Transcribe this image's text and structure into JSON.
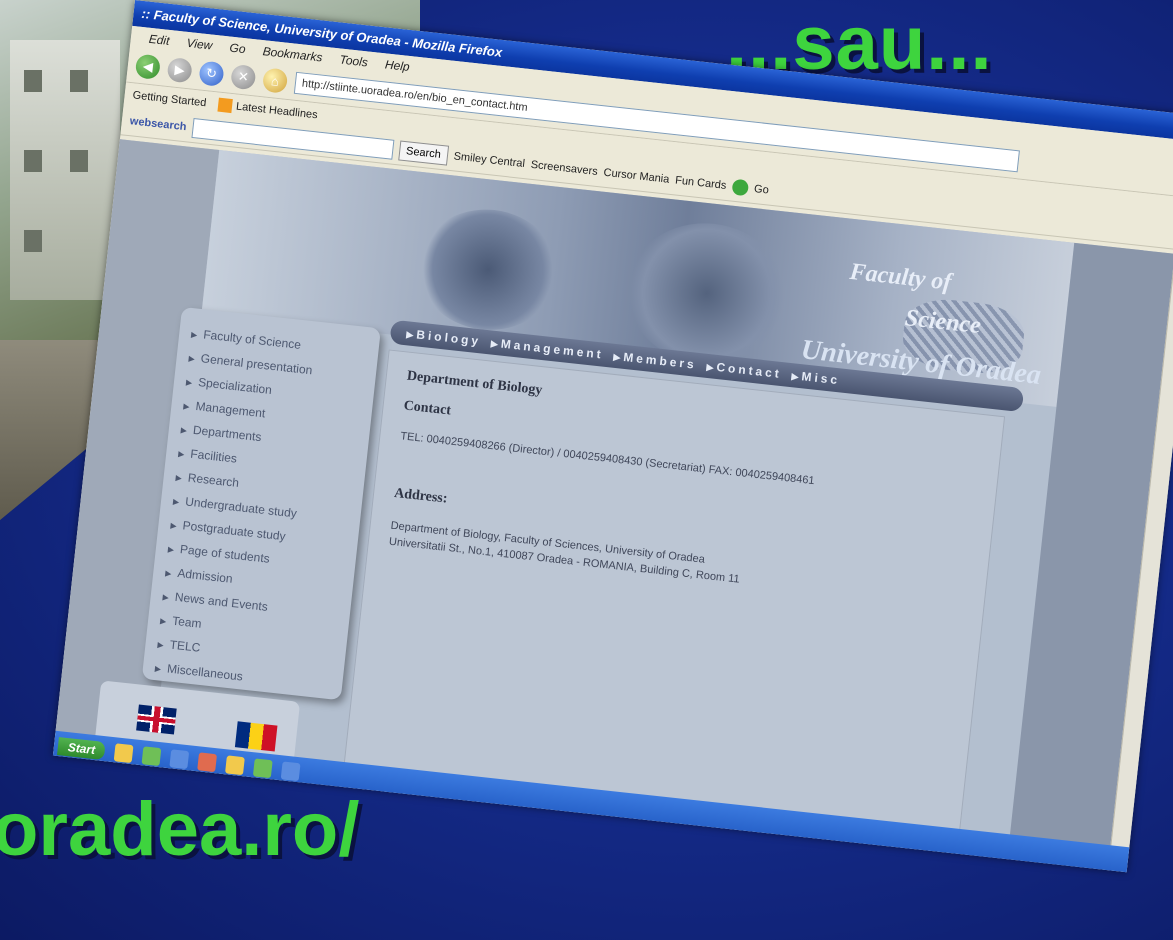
{
  "slide": {
    "title": "...sau...",
    "url_fragment": "oradea.ro/"
  },
  "browser": {
    "window_title": ":: Faculty of Science, University of Oradea - Mozilla Firefox",
    "menu": [
      "Edit",
      "View",
      "Go",
      "Bookmarks",
      "Tools",
      "Help"
    ],
    "address": "http://stiinte.uoradea.ro/en/bio_en_contact.htm",
    "bookmarks": [
      "Getting Started",
      "Latest Headlines"
    ],
    "searchbar": {
      "brand": "websearch",
      "search_button": "Search",
      "tools": [
        "Smiley Central",
        "Screensavers",
        "Cursor Mania",
        "Fun Cards"
      ],
      "go_label": "Go"
    },
    "start_label": "Start"
  },
  "site": {
    "banner": {
      "line1": "Faculty of",
      "line2": "Science",
      "line3": "University of Oradea"
    },
    "sidebar": [
      "Faculty of Science",
      "General presentation",
      "Specialization",
      "Management",
      "Departments",
      "Facilities",
      "Research",
      "Undergraduate study",
      "Postgraduate study",
      "Page of students",
      "Admission",
      "News and Events",
      "Team",
      "TELC",
      "Miscellaneous"
    ],
    "nav": [
      "Biology",
      "Management",
      "Members",
      "Contact",
      "Misc"
    ],
    "department": "Department of Biology",
    "section": "Contact",
    "tel": "TEL: 0040259408266 (Director) / 0040259408430 (Secretariat) FAX: 0040259408461",
    "address_label": "Address:",
    "address_line1": "Department of Biology, Faculty of Sciences, University of Oradea",
    "address_line2": "Universitatii St., No.1, 410087 Oradea - ROMANIA, Building C, Room 11"
  }
}
